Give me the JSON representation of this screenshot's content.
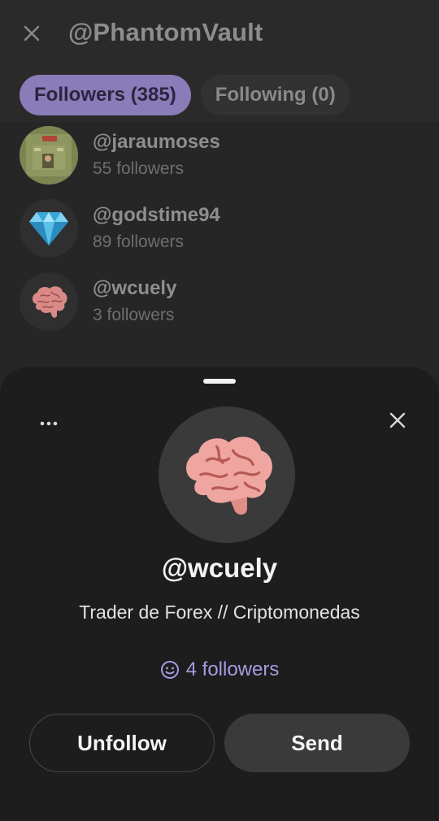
{
  "header": {
    "title": "@PhantomVault",
    "close_icon": "close-icon"
  },
  "tabs": [
    {
      "label": "Followers (385)",
      "active": true
    },
    {
      "label": "Following (0)",
      "active": false
    }
  ],
  "list": [
    {
      "handle": "@jaraumoses",
      "followers": "55 followers",
      "avatar": "photo-avatar"
    },
    {
      "handle": "@godstime94",
      "followers": "89 followers",
      "avatar": "diamond-emoji"
    },
    {
      "handle": "@wcuely",
      "followers": "3 followers",
      "avatar": "brain-emoji"
    }
  ],
  "sheet": {
    "handle": "@wcuely",
    "bio": "Trader de Forex // Criptomonedas",
    "followers_label": "4 followers",
    "followers_icon": "smiley-icon",
    "unfollow_label": "Unfollow",
    "send_label": "Send",
    "more_icon": "more-dots-icon",
    "close_icon": "close-icon",
    "avatar": "brain-emoji"
  },
  "colors": {
    "accent": "#8a7cb8",
    "link": "#a89ae0",
    "sheet_bg": "#1d1d1d",
    "page_bg": "#2a2a2a"
  }
}
